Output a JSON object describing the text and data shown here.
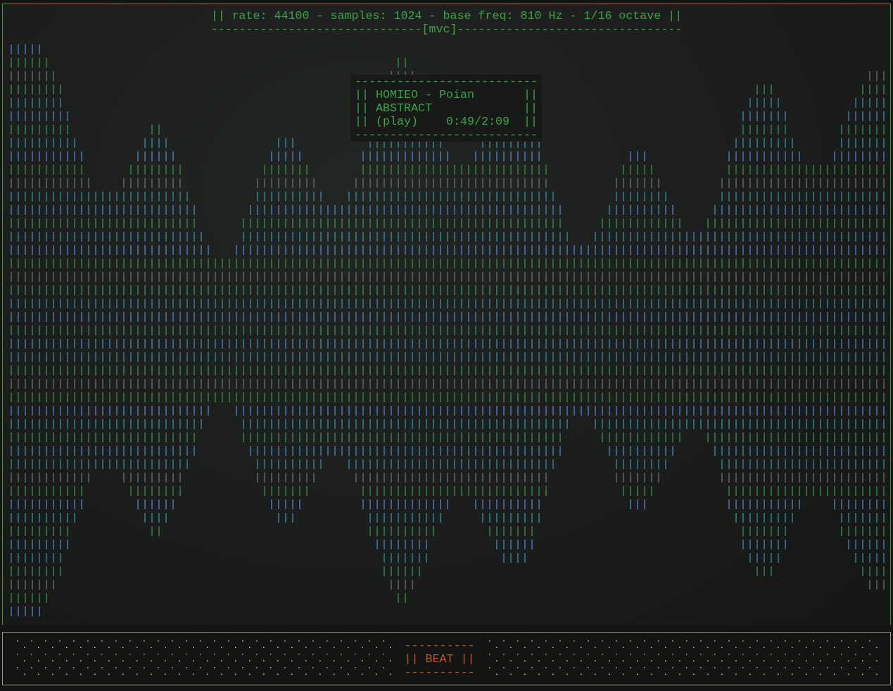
{
  "header": {
    "info": "|| rate: 44100 - samples: 1024 - base freq: 810 Hz - 1/16 octave ||",
    "divider": "------------------------------[mvc]--------------------------------"
  },
  "now_playing": {
    "top_border": "--------------------------",
    "lines": [
      "|| HOMIEO - Poian       ||",
      "|| ABSTRACT             ||",
      "|| (play)    0:49/2:09  ||"
    ],
    "bottom_border": "--------------------------"
  },
  "beat": {
    "top": "----------",
    "label": "|| BEAT ||",
    "bottom": "----------"
  }
}
